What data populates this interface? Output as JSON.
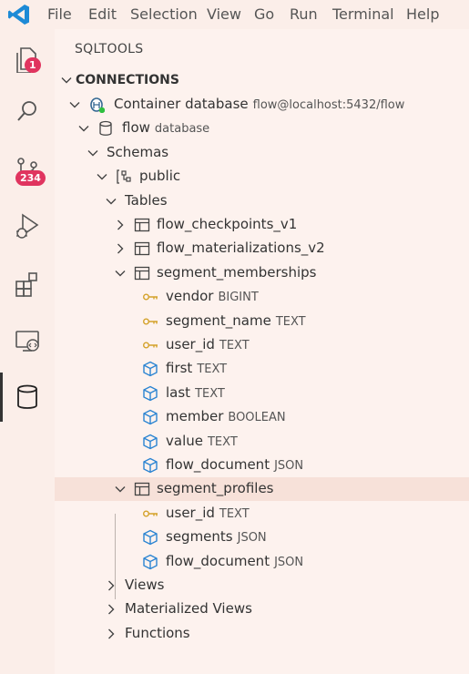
{
  "menu": [
    "File",
    "Edit",
    "Selection",
    "View",
    "Go",
    "Run",
    "Terminal",
    "Help"
  ],
  "activity_bar": [
    {
      "icon": "explorer-icon",
      "badge": "1"
    },
    {
      "icon": "search-icon",
      "badge": ""
    },
    {
      "icon": "source-control-icon",
      "badge": "234"
    },
    {
      "icon": "run-debug-icon",
      "badge": ""
    },
    {
      "icon": "extensions-icon",
      "badge": ""
    },
    {
      "icon": "remote-explorer-icon",
      "badge": ""
    },
    {
      "icon": "database-icon",
      "badge": ""
    }
  ],
  "sidebar": {
    "title": "SQLTOOLS",
    "section": "CONNECTIONS",
    "tree": [
      {
        "level": 0,
        "chev": "down",
        "icon": "postgres-icon",
        "name": "Container database",
        "desc": "flow@localhost:5432/flow"
      },
      {
        "level": 1,
        "chev": "down",
        "icon": "database-icon",
        "name": "flow",
        "desc": "database"
      },
      {
        "level": 2,
        "chev": "down",
        "icon": "",
        "name": "Schemas",
        "desc": ""
      },
      {
        "level": 3,
        "chev": "down",
        "icon": "schema-icon",
        "name": "public",
        "desc": ""
      },
      {
        "level": 4,
        "chev": "down",
        "icon": "",
        "name": "Tables",
        "desc": ""
      },
      {
        "level": 5,
        "chev": "right",
        "icon": "table-icon",
        "name": "flow_checkpoints_v1",
        "desc": ""
      },
      {
        "level": 5,
        "chev": "right",
        "icon": "table-icon",
        "name": "flow_materializations_v2",
        "desc": ""
      },
      {
        "level": 5,
        "chev": "down",
        "icon": "table-icon",
        "name": "segment_memberships",
        "desc": ""
      },
      {
        "level": 6,
        "chev": "",
        "icon": "key-icon",
        "name": "vendor",
        "desc": "BIGINT"
      },
      {
        "level": 6,
        "chev": "",
        "icon": "key-icon",
        "name": "segment_name",
        "desc": "TEXT"
      },
      {
        "level": 6,
        "chev": "",
        "icon": "key-icon",
        "name": "user_id",
        "desc": "TEXT"
      },
      {
        "level": 6,
        "chev": "",
        "icon": "column-icon",
        "name": "first",
        "desc": "TEXT"
      },
      {
        "level": 6,
        "chev": "",
        "icon": "column-icon",
        "name": "last",
        "desc": "TEXT"
      },
      {
        "level": 6,
        "chev": "",
        "icon": "column-icon",
        "name": "member",
        "desc": "BOOLEAN"
      },
      {
        "level": 6,
        "chev": "",
        "icon": "column-icon",
        "name": "value",
        "desc": "TEXT"
      },
      {
        "level": 6,
        "chev": "",
        "icon": "column-icon",
        "name": "flow_document",
        "desc": "JSON"
      },
      {
        "level": 5,
        "chev": "down",
        "icon": "table-icon",
        "name": "segment_profiles",
        "desc": "",
        "selected": true
      },
      {
        "level": 6,
        "chev": "",
        "icon": "key-icon",
        "name": "user_id",
        "desc": "TEXT"
      },
      {
        "level": 6,
        "chev": "",
        "icon": "column-icon",
        "name": "segments",
        "desc": "JSON"
      },
      {
        "level": 6,
        "chev": "",
        "icon": "column-icon",
        "name": "flow_document",
        "desc": "JSON"
      },
      {
        "level": 4,
        "chev": "right",
        "icon": "",
        "name": "Views",
        "desc": ""
      },
      {
        "level": 4,
        "chev": "right",
        "icon": "",
        "name": "Materialized Views",
        "desc": ""
      },
      {
        "level": 4,
        "chev": "right",
        "icon": "",
        "name": "Functions",
        "desc": ""
      }
    ]
  }
}
